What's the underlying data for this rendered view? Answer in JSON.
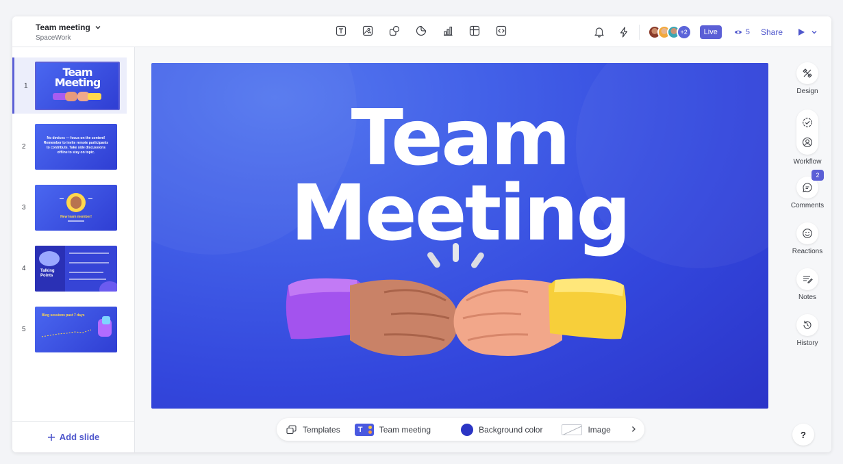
{
  "header": {
    "title": "Team meeting",
    "workspace": "SpaceWork",
    "avatars_more": "+2",
    "live_label": "Live",
    "viewer_count": "5",
    "share_label": "Share"
  },
  "toolbar": {
    "tools": [
      "text-icon",
      "image-icon",
      "shapes-icon",
      "sticker-icon",
      "chart-icon",
      "table-icon",
      "embed-icon"
    ]
  },
  "sidebar": {
    "slides": [
      {
        "number": "1",
        "thumb_title_1": "Team",
        "thumb_title_2": "Meeting"
      },
      {
        "number": "2",
        "thumb_text": "No devices — focus on the content! Remember to invite remote participants to contribute. Take side discussions offline to stay on topic."
      },
      {
        "number": "3",
        "thumb_text": "New team member!"
      },
      {
        "number": "4",
        "thumb_text": "Talking Points"
      },
      {
        "number": "5",
        "thumb_text": "Blog sessions past 7 days"
      }
    ],
    "add_slide_label": "Add slide"
  },
  "canvas": {
    "title_line_1": "Team",
    "title_line_2": "Meeting"
  },
  "rail": {
    "design": "Design",
    "workflow": "Workflow",
    "comments": "Comments",
    "comments_badge": "2",
    "reactions": "Reactions",
    "notes": "Notes",
    "history": "History",
    "help": "?"
  },
  "bottombar": {
    "templates": "Templates",
    "theme_chip": "T",
    "theme": "Team meeting",
    "background": "Background color",
    "image": "Image"
  },
  "colors": {
    "accent": "#5b5fd6",
    "canvas_bg": "#3347dd"
  }
}
